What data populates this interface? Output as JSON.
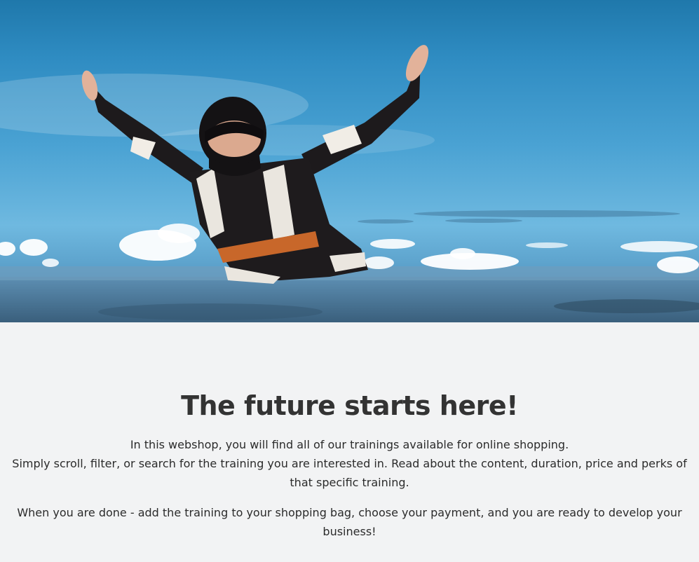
{
  "hero": {
    "image": "skydiver-freefall-photo"
  },
  "main": {
    "headline": "The future starts here!",
    "intro_line_1": "In this webshop, you will find all of our trainings available for online shopping.",
    "intro_line_2": "Simply scroll, filter, or search for the training you are interested in. Read about the content, duration, price and perks of that specific training.",
    "outro": "When you are done - add the training to your shopping bag, choose your payment, and you are ready to develop your business!"
  }
}
